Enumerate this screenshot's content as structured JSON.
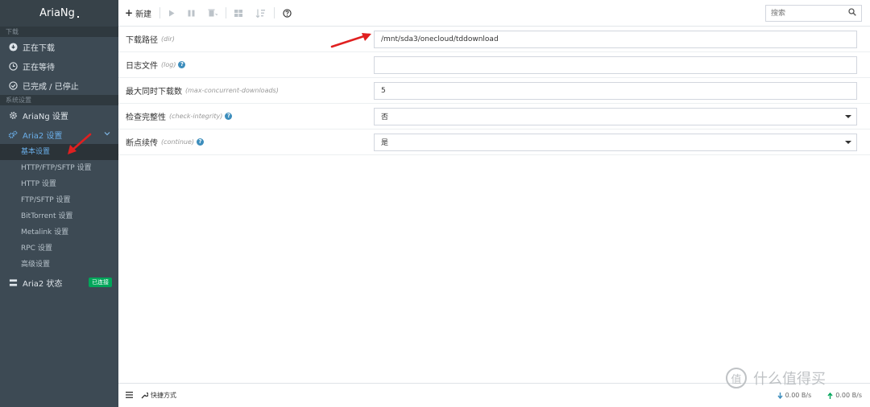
{
  "app": {
    "title": "AriaNg"
  },
  "sidebar": {
    "section_downloads": "下载",
    "downloading": "正在下载",
    "waiting": "正在等待",
    "stopped": "已完成 / 已停止",
    "section_settings": "系统设置",
    "ariang_settings": "AriaNg 设置",
    "aria2_settings": "Aria2 设置",
    "sub_items": [
      "基本设置",
      "HTTP/FTP/SFTP 设置",
      "HTTP 设置",
      "FTP/SFTP 设置",
      "BitTorrent 设置",
      "Metalink 设置",
      "RPC 设置",
      "高级设置"
    ],
    "aria2_status": "Aria2 状态",
    "status_badge": "已连接"
  },
  "toolbar": {
    "new_label": "新建",
    "search_placeholder": "搜索"
  },
  "settings": [
    {
      "label": "下载路径",
      "key": "(dir)",
      "help": false,
      "value": "/mnt/sda3/onecloud/tddownload",
      "type": "text"
    },
    {
      "label": "日志文件",
      "key": "(log)",
      "help": true,
      "value": "",
      "type": "text"
    },
    {
      "label": "最大同时下载数",
      "key": "(max-concurrent-downloads)",
      "help": false,
      "value": "5",
      "type": "text"
    },
    {
      "label": "检查完整性",
      "key": "(check-integrity)",
      "help": true,
      "value": "否",
      "type": "select"
    },
    {
      "label": "断点续传",
      "key": "(continue)",
      "help": true,
      "value": "是",
      "type": "select"
    }
  ],
  "footer": {
    "shortcut": "快捷方式",
    "download_speed": "0.00 B/s",
    "upload_speed": "0.00 B/s"
  },
  "watermark": {
    "text": "什么值得买",
    "mark": "值"
  },
  "colors": {
    "sidebar": "#3d4a54",
    "accent": "#3c8dbc",
    "badge": "#00a65a",
    "arrow": "#e02020"
  }
}
